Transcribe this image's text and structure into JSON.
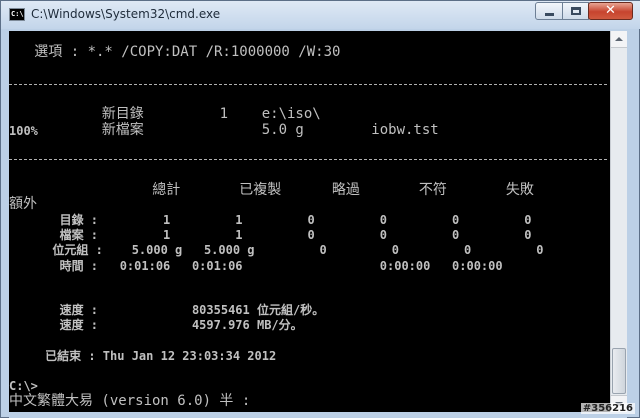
{
  "window": {
    "title": "C:\\Windows\\System32\\cmd.exe",
    "close_label": "✕"
  },
  "console": {
    "options": "   選項 : *.* /COPY:DAT /R:1000000 /W:30",
    "dir_line": "           新目錄         1    e:\\iso\\",
    "file_pct": "100%",
    "file_line": "           新檔案              5.0 g        iobw.tst",
    "stats_header": "                 總計       已複製      略過       不符       失敗",
    "extra_label": "額外",
    "rows": [
      "       目錄 :         1         1         0         0         0         0",
      "       檔案 :         1         1         0         0         0         0",
      "      位元組 :    5.000 g   5.000 g         0         0         0         0",
      "       時間 :   0:01:06   0:01:06                   0:00:00   0:00:00"
    ],
    "speed1": "       速度 :             80355461 位元組/秒。",
    "speed2": "       速度 :             4597.976 MB/分。",
    "ended": "     已結束 : Thu Jan 12 23:03:34 2012",
    "prompt": "C:\\>",
    "ime": "中文繁體大易 (version 6.0) 半 :"
  },
  "watermark": "#356216"
}
